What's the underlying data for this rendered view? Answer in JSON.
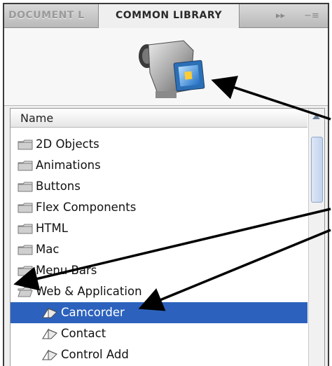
{
  "tabs": {
    "document_label": "DOCUMENT L",
    "common_label": "COMMON LIBRARY",
    "expand_glyph": "▸▸",
    "menu_glyph": "−≡"
  },
  "list": {
    "header": "Name",
    "folders": [
      "2D Objects",
      "Animations",
      "Buttons",
      "Flex Components",
      "HTML",
      "Mac",
      "Menu Bars",
      "Web & Application"
    ],
    "symbols": [
      "Camcorder",
      "Contact",
      "Control Add"
    ],
    "selected": "Camcorder"
  },
  "icons": {
    "preview": "camcorder-icon",
    "folder": "folder-icon",
    "open_folder": "open-folder-icon",
    "symbol": "movieclip-symbol-icon"
  },
  "colors": {
    "selection": "#2c62bd",
    "arrow": "#000000"
  }
}
